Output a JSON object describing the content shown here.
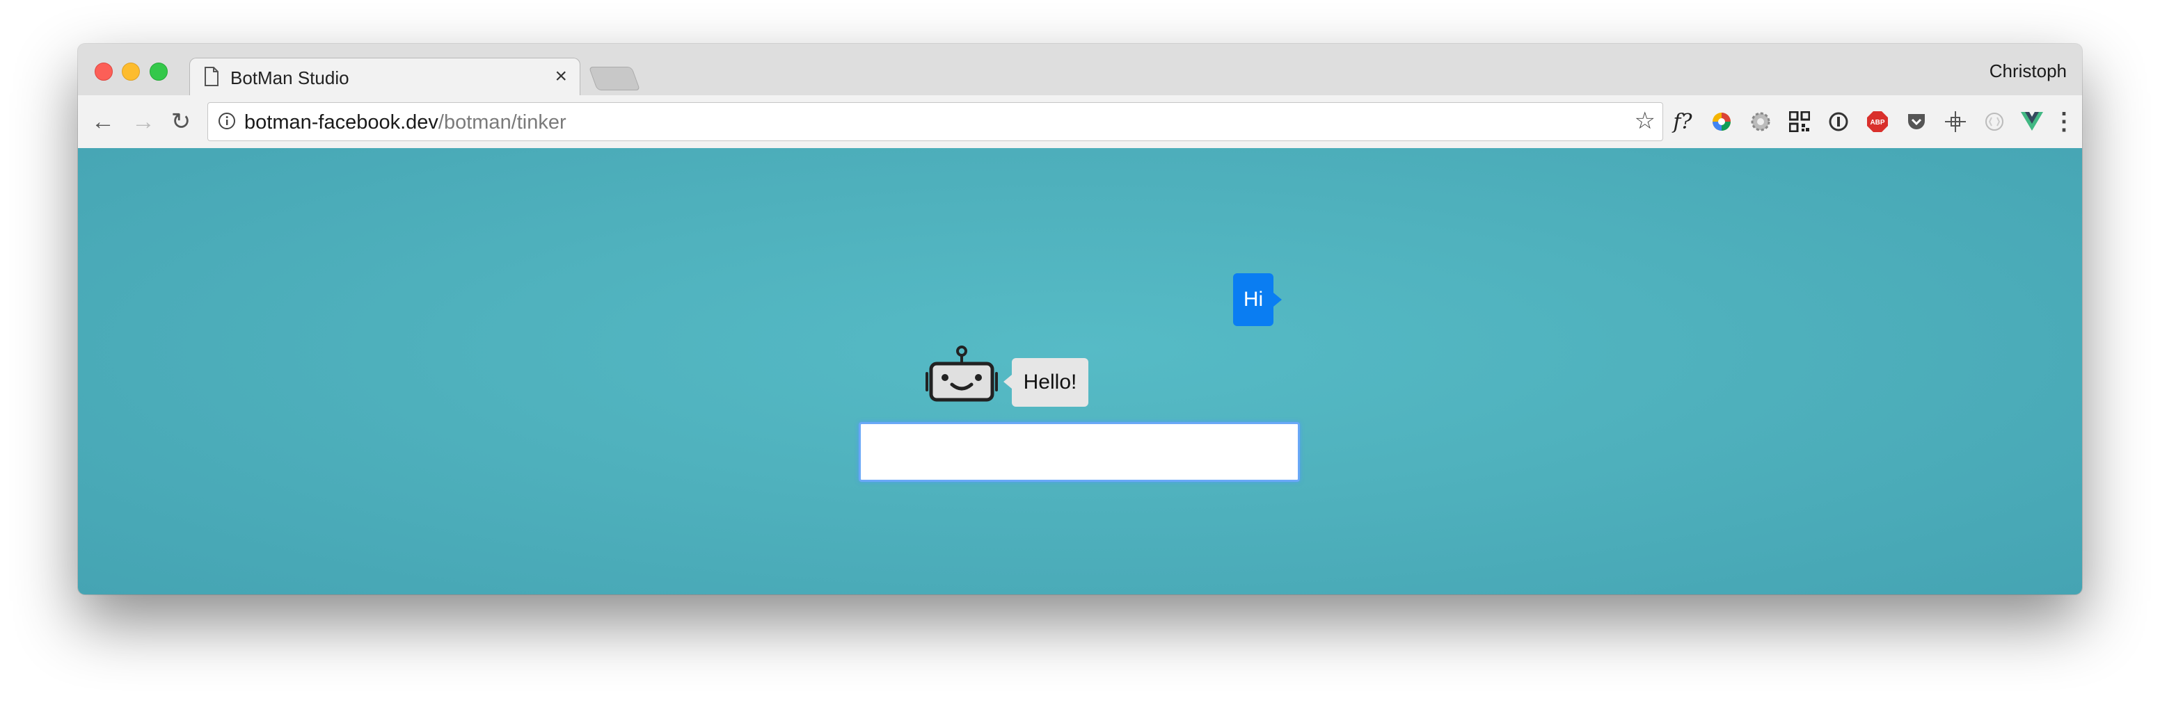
{
  "window": {
    "tab": {
      "title": "BotMan Studio",
      "close_label": "×"
    },
    "profile_name": "Christoph"
  },
  "toolbar": {
    "back_label": "←",
    "forward_label": "→",
    "reload_label": "↻",
    "url_host": "botman-facebook.dev",
    "url_path": "/botman/tinker",
    "bookmark_label": "☆",
    "extensions": [
      {
        "name": "function-icon",
        "glyph": "f?"
      },
      {
        "name": "color-wheel-icon"
      },
      {
        "name": "gear-extension-icon"
      },
      {
        "name": "qr-code-icon"
      },
      {
        "name": "onepassword-icon"
      },
      {
        "name": "adblock-plus-icon",
        "glyph": "ABP"
      },
      {
        "name": "pocket-icon"
      },
      {
        "name": "crosshair-icon"
      },
      {
        "name": "circle-extension-icon"
      },
      {
        "name": "vue-devtools-icon"
      }
    ],
    "menu_label": "⋮"
  },
  "chat": {
    "user_message": "Hi",
    "bot_message": "Hello!",
    "input_value": "",
    "colors": {
      "background": "#50b4c0",
      "user_bubble": "#0a7df2",
      "bot_bubble": "#e6e6e6",
      "input_focus": "#6aa8f7"
    }
  }
}
